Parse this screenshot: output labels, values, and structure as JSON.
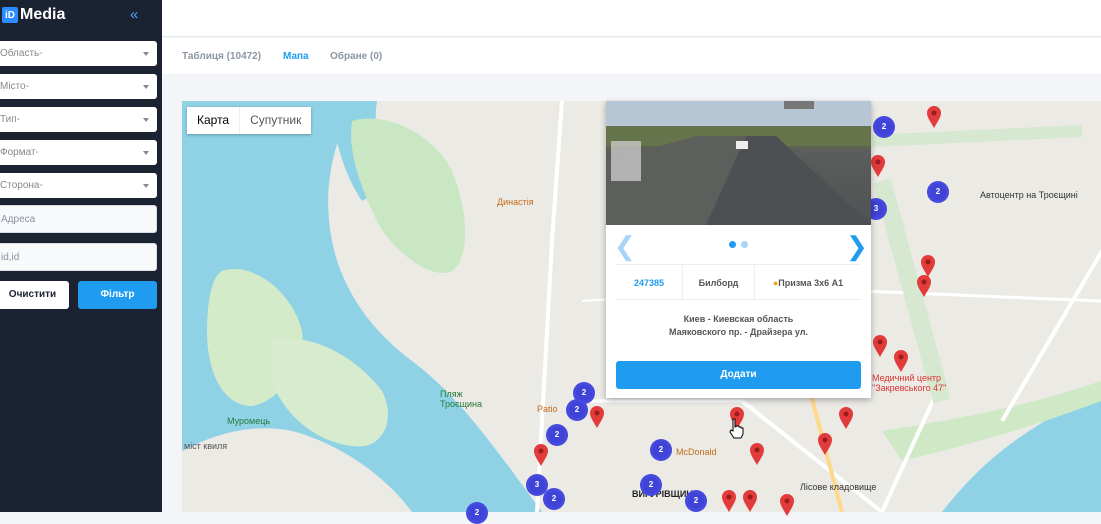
{
  "sidebar": {
    "logo_mark": "iD",
    "logo_text": "Media",
    "filters": [
      "Область-",
      "Місто-",
      "Тип-",
      "Формат-",
      "Сторона-"
    ],
    "address_placeholder": "Адреса",
    "id_placeholder": "id,id",
    "clear_label": "Очистити",
    "filter_label": "Фільтр"
  },
  "tabs": [
    "Таблиця (10472)",
    "Мапа",
    "Обране (0)"
  ],
  "map": {
    "type_map": "Карта",
    "type_sat": "Супутник",
    "labels": [
      "Династія",
      "Автоцентр на Троєщині",
      "Пляж Троєщина",
      "Patio",
      "Муромець",
      "міст квиля",
      "McDonald",
      "Медичний центр \"Закревського 47\"",
      "Лісове кладовище",
      "ВИГУРІВЩИНА"
    ],
    "clusters": [
      "2",
      "2",
      "3",
      "2",
      "2",
      "2",
      "2",
      "2",
      "3",
      "2",
      "2",
      "2"
    ]
  },
  "popup": {
    "id": "247385",
    "type": "Билборд",
    "format": "Призма 3х6 А1",
    "address_line1": "Киев - Киевская область",
    "address_line2": "Маяковского пр. - Драйзера ул.",
    "add_label": "Додати"
  },
  "colors": {
    "accent": "#1f9cf0",
    "sidebar": "#1b2232",
    "pin": "#e23b3b",
    "cluster": "#3f43d8"
  }
}
